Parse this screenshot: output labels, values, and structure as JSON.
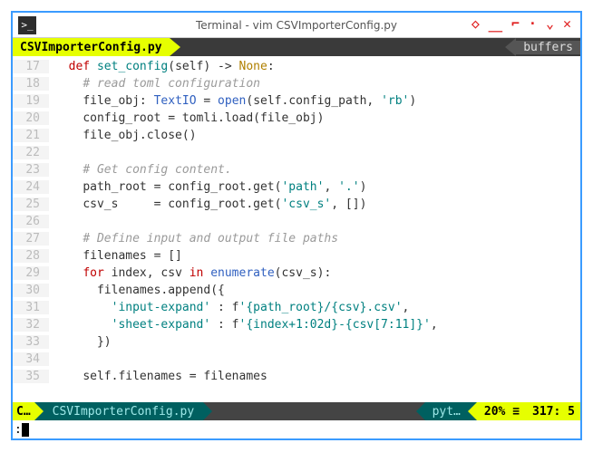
{
  "window": {
    "title": "Terminal - vim CSVImporterConfig.py"
  },
  "tabs": {
    "active": "CSVImporterConfig.py",
    "right_label": "buffers"
  },
  "gutter_start": 17,
  "code": {
    "l17": {
      "kw": "def ",
      "fn": "set_config",
      "sig1": "(",
      "self": "self",
      "sig2": ") -> ",
      "ret": "None",
      "sig3": ":"
    },
    "l18": "# read toml configuration",
    "l19": {
      "a": "file_obj: ",
      "ty": "TextIO",
      "b": " = ",
      "fn": "open",
      "c": "(",
      "self": "self",
      "d": ".config_path, ",
      "s": "'rb'",
      "e": ")"
    },
    "l20": {
      "a": "config_root = tomli.load(file_obj)"
    },
    "l21": {
      "a": "file_obj.close()"
    },
    "l22": "",
    "l23": "# Get config content.",
    "l24": {
      "a": "path_root = config_root.get(",
      "s1": "'path'",
      "b": ", ",
      "s2": "'.'",
      "c": ")"
    },
    "l25": {
      "a": "csv_s     = config_root.get(",
      "s1": "'csv_s'",
      "b": ", [])"
    },
    "l26": "",
    "l27": "# Define input and output file paths",
    "l28": "filenames = []",
    "l29": {
      "kw1": "for",
      "a": " index, csv ",
      "kw2": "in",
      "b": " ",
      "fn": "enumerate",
      "c": "(csv_s):"
    },
    "l30": "filenames.append({",
    "l31": {
      "s1": "'input-expand'",
      "a": " : f",
      "s2": "'{path_root}/{csv}.csv'",
      "b": ","
    },
    "l32": {
      "s1": "'sheet-expand'",
      "a": " : f",
      "s2": "'{index+1:02d}-{csv[7:11]}'",
      "b": ","
    },
    "l33": "})",
    "l34": "",
    "l35": {
      "self": "self",
      "a": ".filenames = filenames"
    }
  },
  "status": {
    "mode": "C…",
    "file": "CSVImporterConfig.py",
    "filetype": "pyt…",
    "percent": "20% ≡",
    "position": "317:  5"
  },
  "cmdline": ":"
}
